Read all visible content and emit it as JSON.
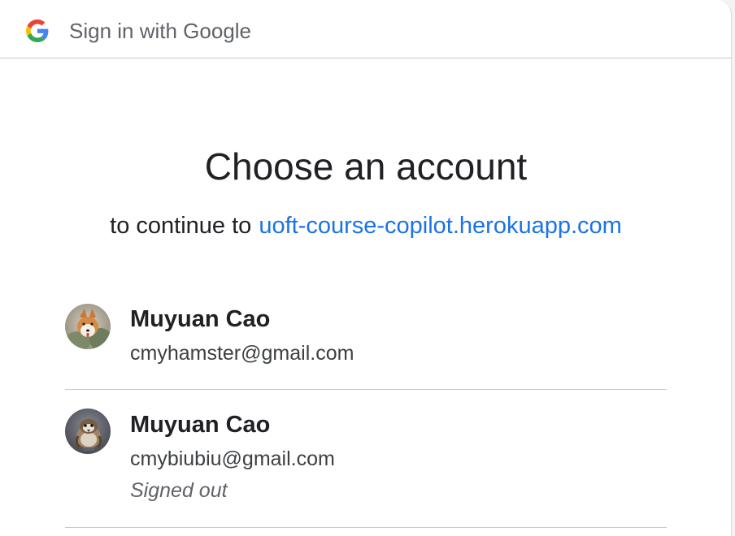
{
  "header": {
    "title": "Sign in with Google",
    "logo_icon": "google-g-icon"
  },
  "main": {
    "title": "Choose an account",
    "subtitle_prefix": "to continue to",
    "subtitle_link": "uoft-course-copilot.herokuapp.com"
  },
  "accounts": [
    {
      "name": "Muyuan Cao",
      "email": "cmyhamster@gmail.com",
      "avatar_icon": "fox-photo-avatar"
    },
    {
      "name": "Muyuan Cao",
      "email": "cmybiubiu@gmail.com",
      "status": "Signed out",
      "avatar_icon": "sparrow-photo-avatar"
    }
  ],
  "colors": {
    "link": "#1a73e8",
    "divider": "#c8c9cc",
    "secondary_text": "#5f6368"
  }
}
